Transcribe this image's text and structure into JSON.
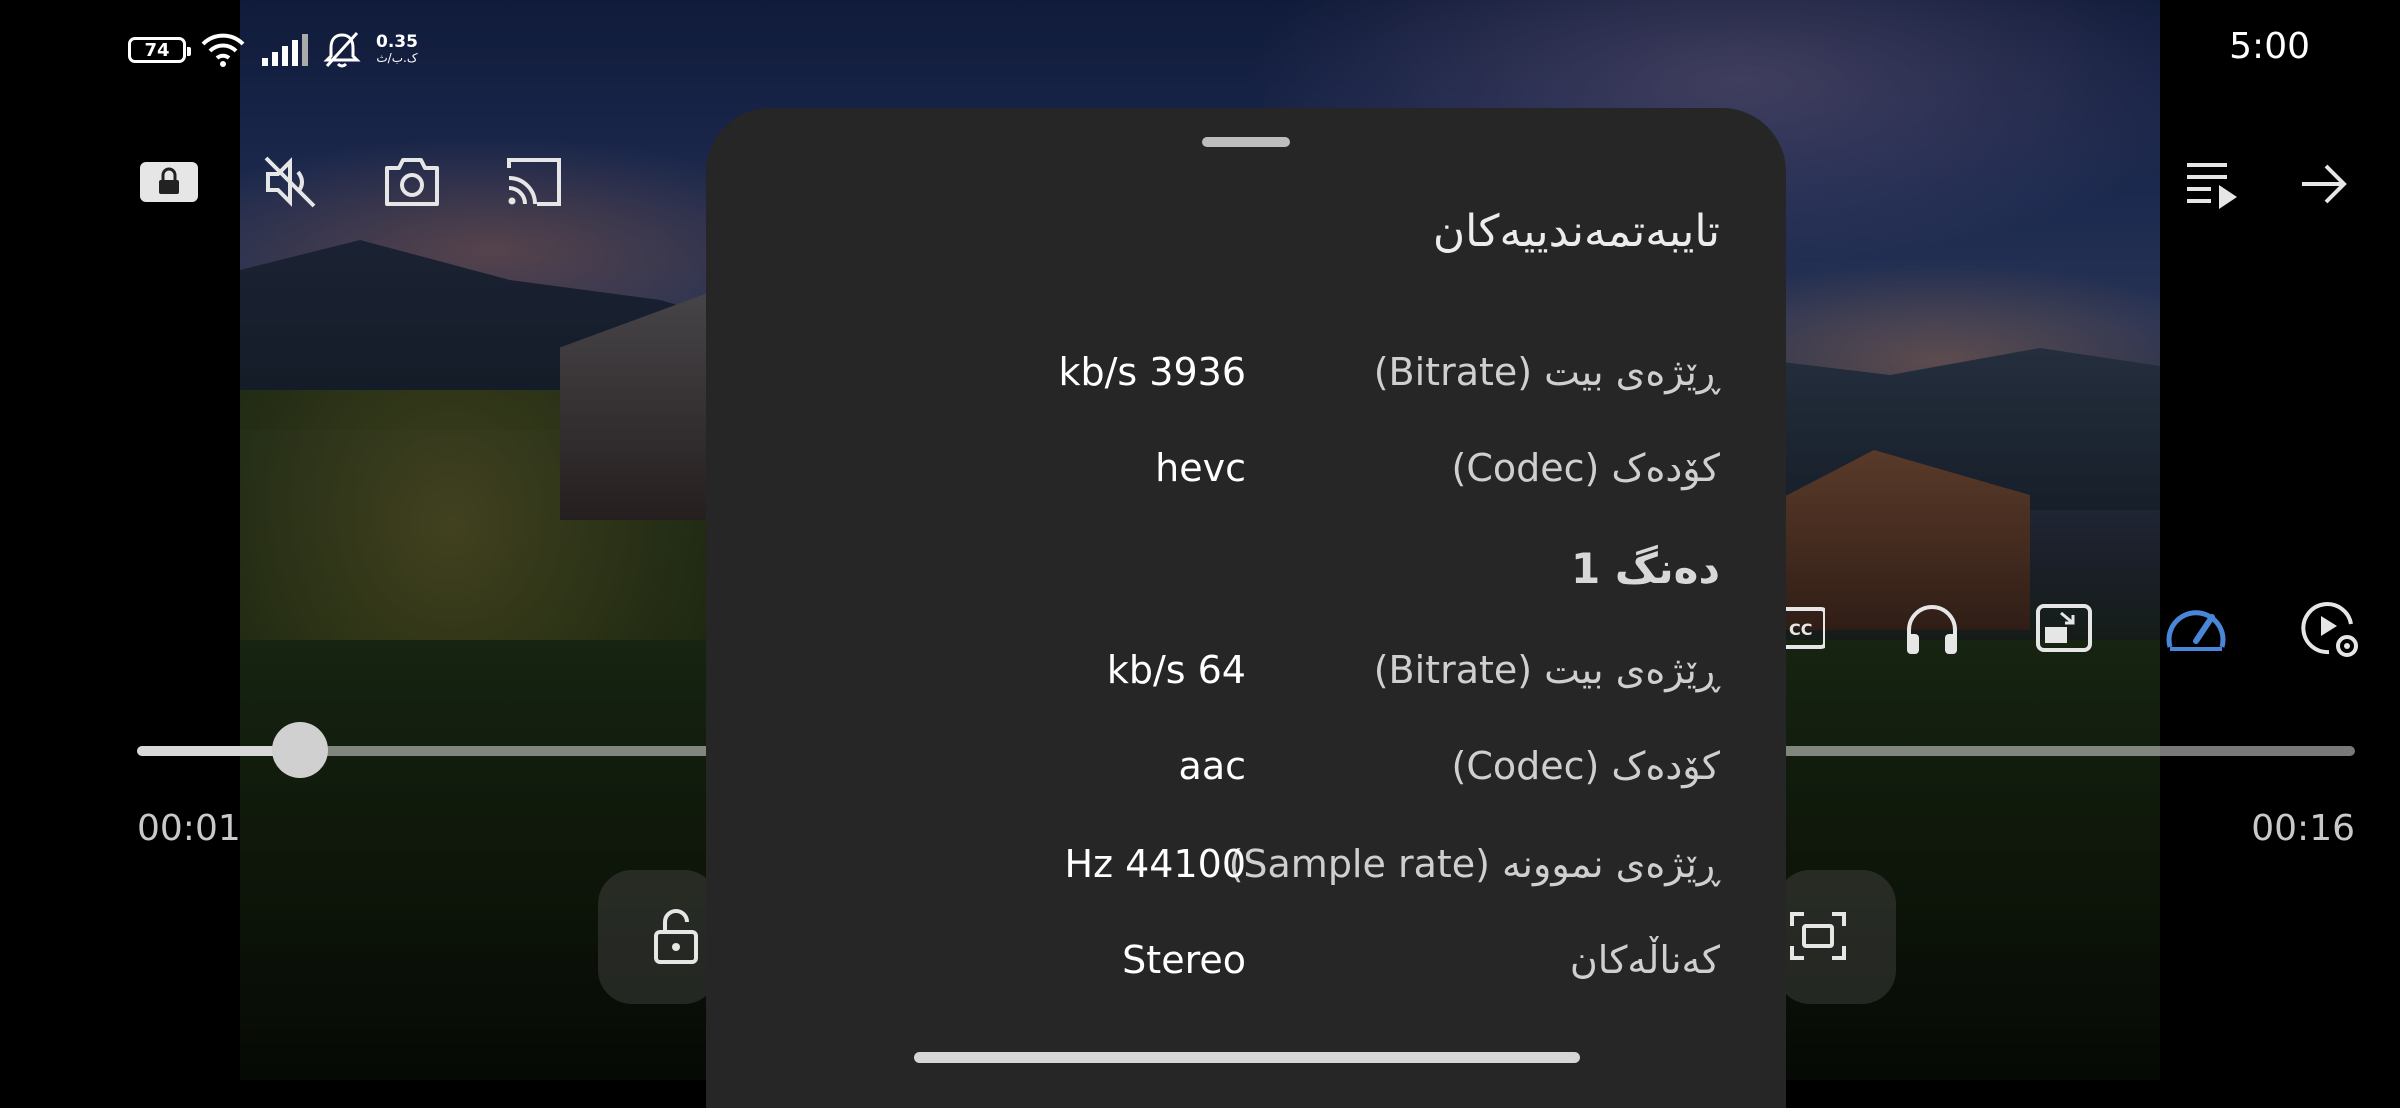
{
  "status_bar": {
    "battery": "74",
    "net_speed_value": "0.35",
    "net_speed_unit": "ک.ب/ث",
    "clock": "5:00"
  },
  "player": {
    "elapsed": "00:01",
    "duration": "00:16",
    "progress_fraction": 0.073,
    "top_left_icons": [
      "lock-screen-icon",
      "mute-icon",
      "screenshot-camera-icon",
      "cast-icon"
    ],
    "top_right_icons": [
      "playlist-icon",
      "forward-arrow-icon"
    ],
    "right_tool_icons": [
      "subtitle-cc-icon",
      "audio-headphones-icon",
      "pip-icon",
      "playback-speed-icon",
      "video-settings-icon"
    ],
    "accent_color": "#4a86d8"
  },
  "sheet": {
    "title": "تایبەتمەندییەکان",
    "video_rows": [
      {
        "label": "ڕێژەی بیت (Bitrate)",
        "value": "kb/s 3936"
      },
      {
        "label": "کۆدەک (Codec)",
        "value": "hevc"
      }
    ],
    "audio_section": "دەنگ 1",
    "audio_rows": [
      {
        "label": "ڕێژەی بیت (Bitrate)",
        "value": "kb/s 64"
      },
      {
        "label": "کۆدەک (Codec)",
        "value": "aac"
      },
      {
        "label": "ڕێژەی نموونە (Sample rate)",
        "value": "Hz 44100"
      },
      {
        "label": "کەناڵەکان",
        "value": "Stereo"
      }
    ]
  }
}
